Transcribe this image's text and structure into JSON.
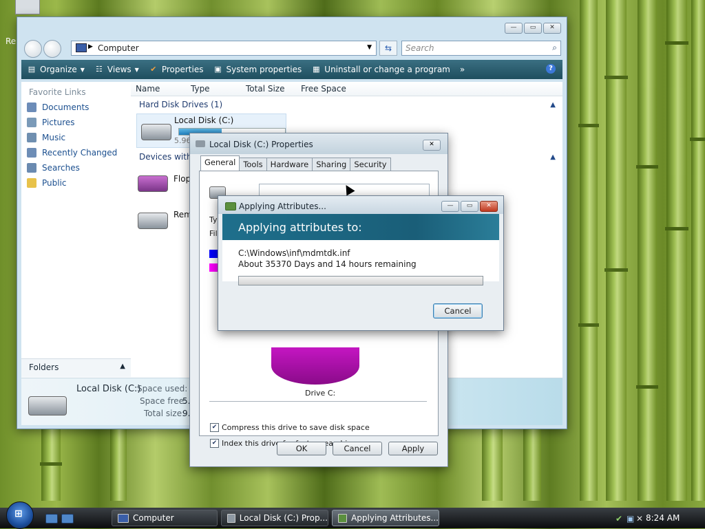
{
  "desktop": {
    "icon_label": "Re"
  },
  "explorer": {
    "address": "Computer",
    "search_placeholder": "Search",
    "toolbar": {
      "organize": "Organize",
      "views": "Views",
      "properties": "Properties",
      "system_properties": "System properties",
      "uninstall": "Uninstall or change a program",
      "more": "»"
    },
    "favorite_links_title": "Favorite Links",
    "favorite_links": [
      "Documents",
      "Pictures",
      "Music",
      "Recently Changed",
      "Searches",
      "Public"
    ],
    "folders_label": "Folders",
    "columns": [
      "Name",
      "Type",
      "Total Size",
      "Free Space"
    ],
    "hard_disk_group": "Hard Disk Drives (1)",
    "local_disk_label": "Local Disk (C:)",
    "local_disk_free_partial": "5.96",
    "removable_group_partial": "Devices with R",
    "floppy_partial": "Flop",
    "removable_partial": "Rem",
    "details": {
      "name": "Local Disk (C:)",
      "space_used_label": "Space used:",
      "space_free_label": "Space free:",
      "space_free_partial": "5.",
      "total_size_label": "Total size:",
      "total_size_partial": "9."
    }
  },
  "properties_dialog": {
    "title": "Local Disk (C:) Properties",
    "tabs": [
      "General",
      "Tools",
      "Hardware",
      "Sharing",
      "Security"
    ],
    "type_partial": "Typ",
    "file_partial": "File",
    "drive_label": "Drive C:",
    "compress_label": "Compress this drive to save disk space",
    "index_label": "Index this drive for faster searching",
    "compress_checked": true,
    "index_checked": true,
    "ok": "OK",
    "cancel": "Cancel",
    "apply": "Apply",
    "colors": {
      "used": "#0000ff",
      "free": "#ff00ff"
    }
  },
  "applying_dialog": {
    "title": "Applying Attributes...",
    "heading": "Applying attributes to:",
    "file": "C:\\Windows\\inf\\mdmtdk.inf",
    "remaining": "About 35370 Days and 14 hours remaining",
    "progress": 0,
    "cancel": "Cancel"
  },
  "taskbar": {
    "tasks": [
      "Computer",
      "Local Disk (C:) Prop...",
      "Applying Attributes..."
    ],
    "active_index": 2,
    "clock": "8:24 AM"
  }
}
